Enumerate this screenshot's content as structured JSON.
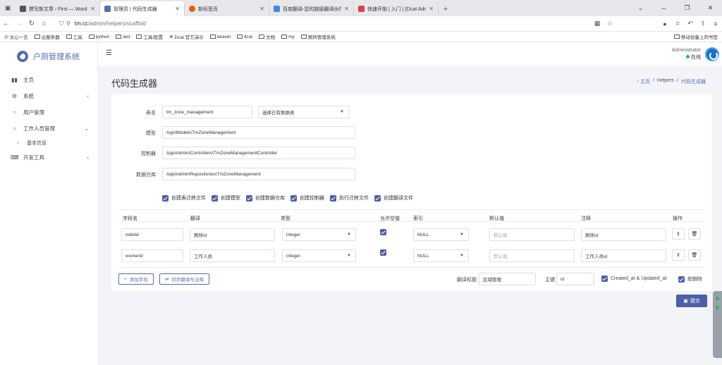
{
  "browser": {
    "tabs": [
      {
        "title": "撰写新文章 ‹ First — WordPress",
        "fav": "#555"
      },
      {
        "title": "管理员 | 代码生成器",
        "fav": "#586cb1",
        "active": true
      },
      {
        "title": "新标签页",
        "fav": "#e66000"
      },
      {
        "title": "百度翻译-您的超级翻译伙伴（支持",
        "fav": "#3b8de4"
      },
      {
        "title": "快速开始 | 入门 | {Dcat Admin}",
        "fav": "#d64545"
      }
    ],
    "url_host": "tm.cc",
    "url_path": "/admin/helpers/scaffold",
    "bookmarks": [
      "文心一言",
      "云服务器",
      "工具",
      "python",
      "last",
      "工具/配置",
      "Dcat 官方演示",
      "laravel",
      "dcat",
      "文档",
      "my",
      "厕所管理系统"
    ],
    "mobile_bookmarks": "移动设备上的书签"
  },
  "app": {
    "name": "户厕管理系统"
  },
  "sidebar": {
    "items": [
      {
        "label": "主页",
        "icon": "bar-chart-icon"
      },
      {
        "label": "系统",
        "icon": "gear-icon"
      },
      {
        "label": "用户管理",
        "icon": "circle-icon"
      },
      {
        "label": "工作人员管理",
        "icon": "circle-icon"
      },
      {
        "label": "基本信息",
        "icon": "circle-icon"
      },
      {
        "label": "开发工具",
        "icon": "keyboard-icon"
      }
    ]
  },
  "user": {
    "name": "Administrator",
    "status": "在线"
  },
  "page": {
    "title": "代码生成器"
  },
  "breadcrumb": {
    "home": "主页",
    "mid": "Helpers",
    "current": "代码生成器"
  },
  "form": {
    "table_name_label": "表名",
    "table_name_value": "tm_zone_management",
    "select_table_placeholder": "选择已有数据表",
    "model_label": "模型",
    "model_value": "App\\Models\\TmZoneManagement",
    "controller_label": "控制器",
    "controller_value": "App\\Admin\\Controllers\\TmZoneManagementController",
    "repo_label": "数据仓库",
    "repo_value": "App\\Admin\\Repositories\\TmZoneManagement",
    "options": [
      "创建表迁移文件",
      "创建模型",
      "创建数据仓库",
      "创建控制器",
      "执行迁移文件",
      "创建翻译文件"
    ]
  },
  "fields_table": {
    "headers": {
      "name": "字段名",
      "trans": "翻译",
      "type": "类型",
      "nullable": "允许空值",
      "index": "索引",
      "default": "默认值",
      "comment": "注释",
      "action": "操作"
    },
    "rows": [
      {
        "name": "toiletid",
        "trans": "厕所id",
        "type": "integer",
        "index": "NULL",
        "default_ph": "默认值",
        "comment": "厕所id"
      },
      {
        "name": "workerid",
        "trans": "工作人员",
        "type": "integer",
        "index": "NULL",
        "default_ph": "默认值",
        "comment": "工作人员id"
      }
    ]
  },
  "footer_bar": {
    "add_field": "添加字段",
    "sync": "同步翻译与注释",
    "trans_title_label": "翻译标题",
    "trans_title_value": "区域管理",
    "pk_label": "主键",
    "pk_value": "id",
    "timestamps": "Created_at & Updated_at",
    "soft_delete": "软删除"
  },
  "submit": "提交"
}
